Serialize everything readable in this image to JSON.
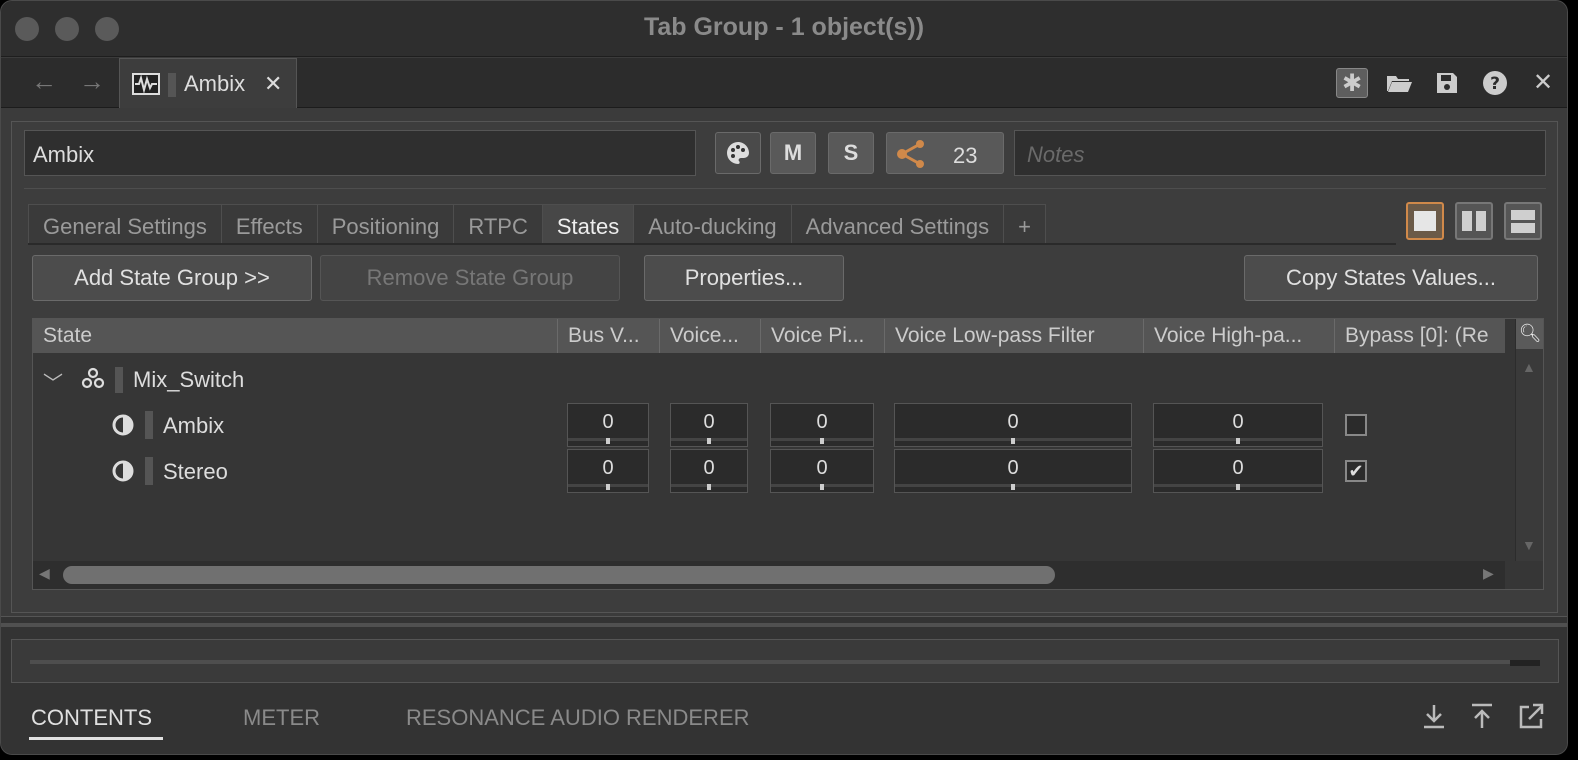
{
  "window": {
    "title": "Tab Group - 1 object(s))"
  },
  "tabbar": {
    "doc_tab_label": "Ambix",
    "close_glyph": "✕"
  },
  "object": {
    "name": "Ambix",
    "mute_label": "M",
    "solo_label": "S",
    "reference_count": "23",
    "notes_placeholder": "Notes"
  },
  "tabs": [
    {
      "label": "General Settings"
    },
    {
      "label": "Effects"
    },
    {
      "label": "Positioning"
    },
    {
      "label": "RTPC"
    },
    {
      "label": "States"
    },
    {
      "label": "Auto-ducking"
    },
    {
      "label": "Advanced Settings"
    },
    {
      "label": "+"
    }
  ],
  "active_tab": "States",
  "actions": {
    "add_state_group": "Add State Group >>",
    "remove_state_group": "Remove State Group",
    "properties": "Properties...",
    "copy_states_values": "Copy States Values..."
  },
  "grid": {
    "columns": [
      "State",
      "Bus V...",
      "Voice...",
      "Voice Pi...",
      "Voice Low-pass Filter",
      "Voice High-pa...",
      "Bypass [0]: (Re"
    ],
    "group": {
      "name": "Mix_Switch",
      "expanded": true
    },
    "rows": [
      {
        "name": "Ambix",
        "values": [
          "0",
          "0",
          "0",
          "0",
          "0"
        ],
        "bypass_checked": false
      },
      {
        "name": "Stereo",
        "values": [
          "0",
          "0",
          "0",
          "0",
          "0"
        ],
        "bypass_checked": true
      }
    ]
  },
  "bottom_tabs": [
    {
      "label": "CONTENTS",
      "active": true
    },
    {
      "label": "METER",
      "active": false
    },
    {
      "label": "RESONANCE AUDIO RENDERER",
      "active": false
    }
  ],
  "colors": {
    "accent": "#d0894a",
    "background": "#3b3b3b"
  }
}
